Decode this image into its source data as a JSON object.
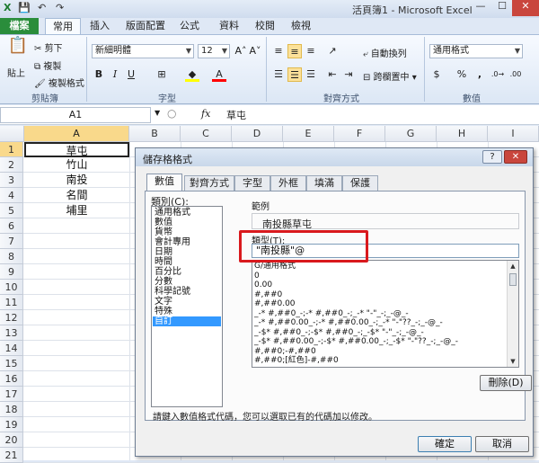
{
  "window": {
    "title": "活頁簿1 - Microsoft Excel",
    "min": "—",
    "max": "☐",
    "close": "✕"
  },
  "quick_access": {
    "app_icon": "excel-icon",
    "save": "💾",
    "undo": "↶",
    "redo": "↷"
  },
  "tabs": {
    "file": "檔案",
    "items": [
      "常用",
      "插入",
      "版面配置",
      "公式",
      "資料",
      "校閱",
      "檢視"
    ],
    "active": "常用"
  },
  "ribbon": {
    "clipboard": {
      "label": "剪貼簿",
      "paste": "貼上",
      "cut": "剪下",
      "copy": "複製",
      "format_painter": "複製格式"
    },
    "font": {
      "label": "字型",
      "name": "新細明體",
      "size": "12",
      "grow": "A˄",
      "shrink": "A˅",
      "bold": "B",
      "italic": "I",
      "underline": "U",
      "fill_color": "#ffff00",
      "font_color": "#ff0000"
    },
    "alignment": {
      "label": "對齊方式",
      "wrap": "自動換列",
      "merge": "跨欄置中"
    },
    "number": {
      "label": "數值",
      "format": "通用格式",
      "currency": "$",
      "percent": "%",
      "comma": ","
    }
  },
  "formula_bar": {
    "name_box": "A1",
    "fx": "fx",
    "content": "草屯"
  },
  "sheet": {
    "columns": [
      "A",
      "B",
      "C",
      "D",
      "E",
      "F",
      "G",
      "H",
      "I"
    ],
    "rows": [
      "1",
      "2",
      "3",
      "4",
      "5",
      "6",
      "7",
      "8",
      "9",
      "10",
      "11",
      "12",
      "13",
      "14",
      "15",
      "16",
      "17",
      "18",
      "19",
      "20",
      "21"
    ],
    "cells": [
      "草屯",
      "竹山",
      "南投",
      "名間",
      "埔里"
    ]
  },
  "dialog": {
    "title": "儲存格格式",
    "help": "?",
    "close": "✕",
    "tabs": [
      "數值",
      "對齊方式",
      "字型",
      "外框",
      "填滿",
      "保護"
    ],
    "active_tab": "數值",
    "category_label": "類別(C):",
    "categories": [
      "通用格式",
      "數值",
      "貨幣",
      "會計專用",
      "日期",
      "時間",
      "百分比",
      "分數",
      "科學記號",
      "文字",
      "特殊",
      "自訂"
    ],
    "selected_category": "自訂",
    "sample_label": "範例",
    "sample_value": "南投縣草屯",
    "type_label": "類型(T):",
    "type_value": "\"南投縣\"@",
    "format_codes": [
      "G/通用格式",
      "0",
      "0.00",
      "#,##0",
      "#,##0.00",
      "_-* #,##0_-;-* #,##0_-;_-* \"-\"_-;_-@_-",
      "_-* #,##0.00_-;-* #,##0.00_-;_-* \"-\"??_-;_-@_-",
      "_-$* #,##0_-;-$* #,##0_-;_-$* \"-\"_-;_-@_-",
      "_-$* #,##0.00_-;-$* #,##0.00_-;_-$* \"-\"??_-;_-@_-",
      "#,##0;-#,##0",
      "#,##0;[紅色]-#,##0"
    ],
    "delete_button": "刪除(D)",
    "hint": "請鍵入數值格式代碼，您可以選取已有的代碼加以修改。",
    "ok": "確定",
    "cancel": "取消"
  }
}
